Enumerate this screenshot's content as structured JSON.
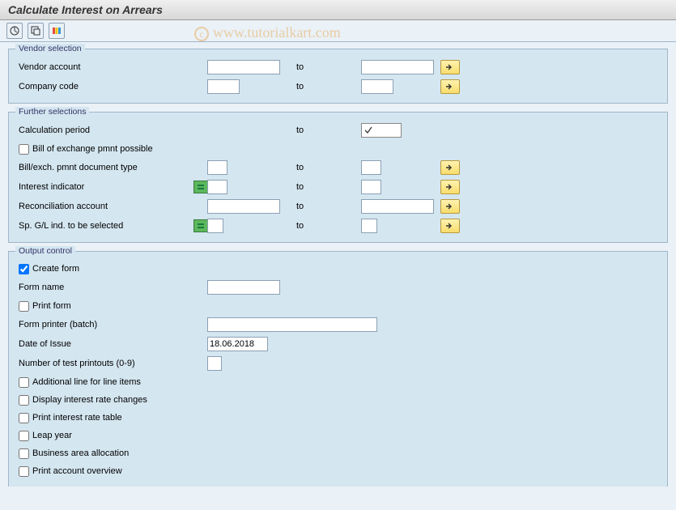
{
  "title": "Calculate Interest on Arrears",
  "watermark": "www.tutorialkart.com",
  "groups": {
    "vendor": {
      "title": "Vendor selection",
      "vendor_account": "Vendor account",
      "company_code": "Company code",
      "to": "to"
    },
    "further": {
      "title": "Further selections",
      "calc_period": "Calculation period",
      "bill_exch_possible": "Bill of exchange pmnt possible",
      "bill_doc_type": "Bill/exch. pmnt document type",
      "interest_indicator": "Interest indicator",
      "recon_account": "Reconciliation account",
      "sp_gl": "Sp. G/L ind. to be selected",
      "to": "to"
    },
    "output": {
      "title": "Output control",
      "create_form": "Create form",
      "form_name": "Form name",
      "print_form": "Print form",
      "form_printer": "Form printer (batch)",
      "date_of_issue": "Date of Issue",
      "date_of_issue_value": "18.06.2018",
      "num_test": "Number of test printouts (0-9)",
      "addl_line": "Additional line for line items",
      "display_changes": "Display interest rate changes",
      "print_table": "Print interest rate table",
      "leap_year": "Leap year",
      "ba_alloc": "Business area allocation",
      "print_overview": "Print account overview"
    }
  }
}
